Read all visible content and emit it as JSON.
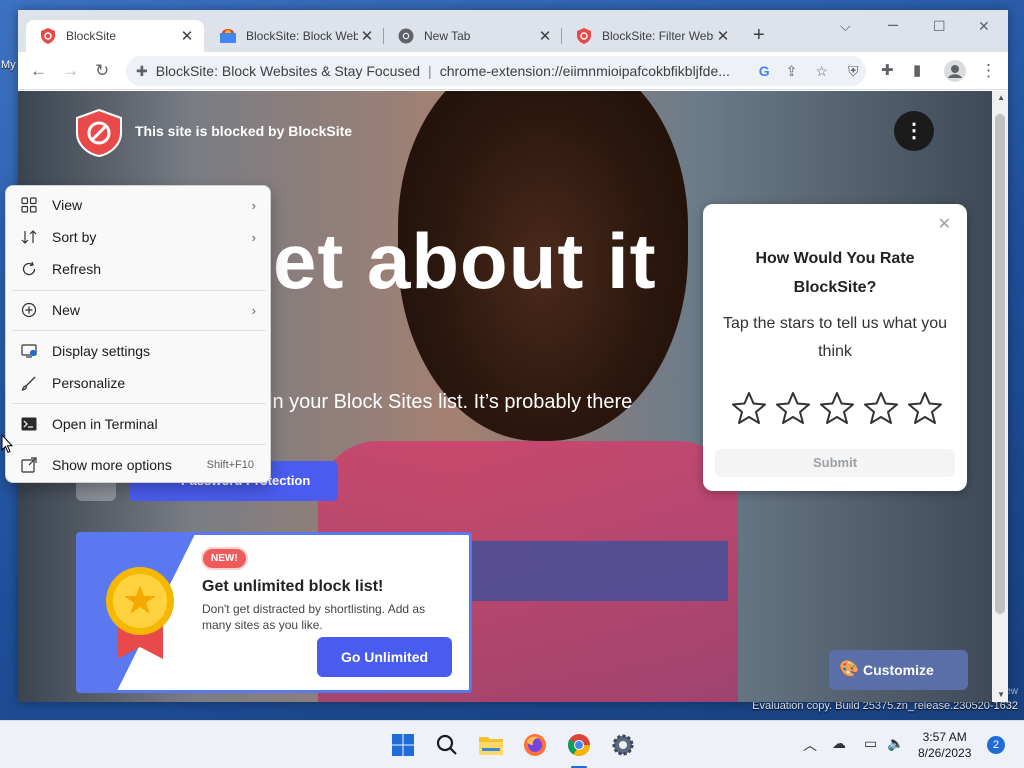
{
  "desktop": {
    "label": "My",
    "evaluation": "Evaluation copy. Build 25375.zn_release.230520-1632",
    "edge_text": "ew"
  },
  "browser": {
    "tabs": [
      {
        "title": "BlockSite",
        "favicon": "blocksite-shield-icon",
        "active": true
      },
      {
        "title": "BlockSite: Block Websites",
        "favicon": "chrome-web-store-icon",
        "active": false
      },
      {
        "title": "New Tab",
        "favicon": "chrome-icon",
        "active": false
      },
      {
        "title": "BlockSite: Filter Websites",
        "favicon": "blocksite-shield-icon",
        "active": false
      }
    ],
    "new_tab_label": "+",
    "omnibox": {
      "site_name": "BlockSite: Block Websites & Stay Focused",
      "separator": "|",
      "url": "chrome-extension://eiimnmioipafcokbfikbljfde..."
    }
  },
  "page": {
    "blocked_text": "This site is blocked by BlockSite",
    "headline": "et about it",
    "subline": "in your Block Sites list. It’s probably there",
    "password_button": "Password Protection",
    "promo": {
      "badge": "NEW!",
      "title": "Get unlimited block list!",
      "description": "Don't get distracted by shortlisting. Add as many sites as you like.",
      "button": "Go Unlimited"
    },
    "customize_button": "Customize Page"
  },
  "rating": {
    "title": "How Would You Rate BlockSite?",
    "subtitle": "Tap the stars to tell us what you think",
    "stars": 5,
    "submit": "Submit"
  },
  "context_menu": {
    "view": "View",
    "sort_by": "Sort by",
    "refresh": "Refresh",
    "new": "New",
    "display_settings": "Display settings",
    "personalize": "Personalize",
    "open_terminal": "Open in Terminal",
    "show_more": "Show more options",
    "show_more_shortcut": "Shift+F10"
  },
  "taskbar": {
    "time": "3:57 AM",
    "date": "8/26/2023",
    "notification_count": "2",
    "apps": [
      "windows-start-icon",
      "search-icon",
      "file-explorer-icon",
      "firefox-icon",
      "chrome-icon",
      "settings-icon"
    ]
  },
  "colors": {
    "accent": "#4a5cf0",
    "blocksite_red": "#e84a4a",
    "badge_red": "#ef5a5a"
  }
}
